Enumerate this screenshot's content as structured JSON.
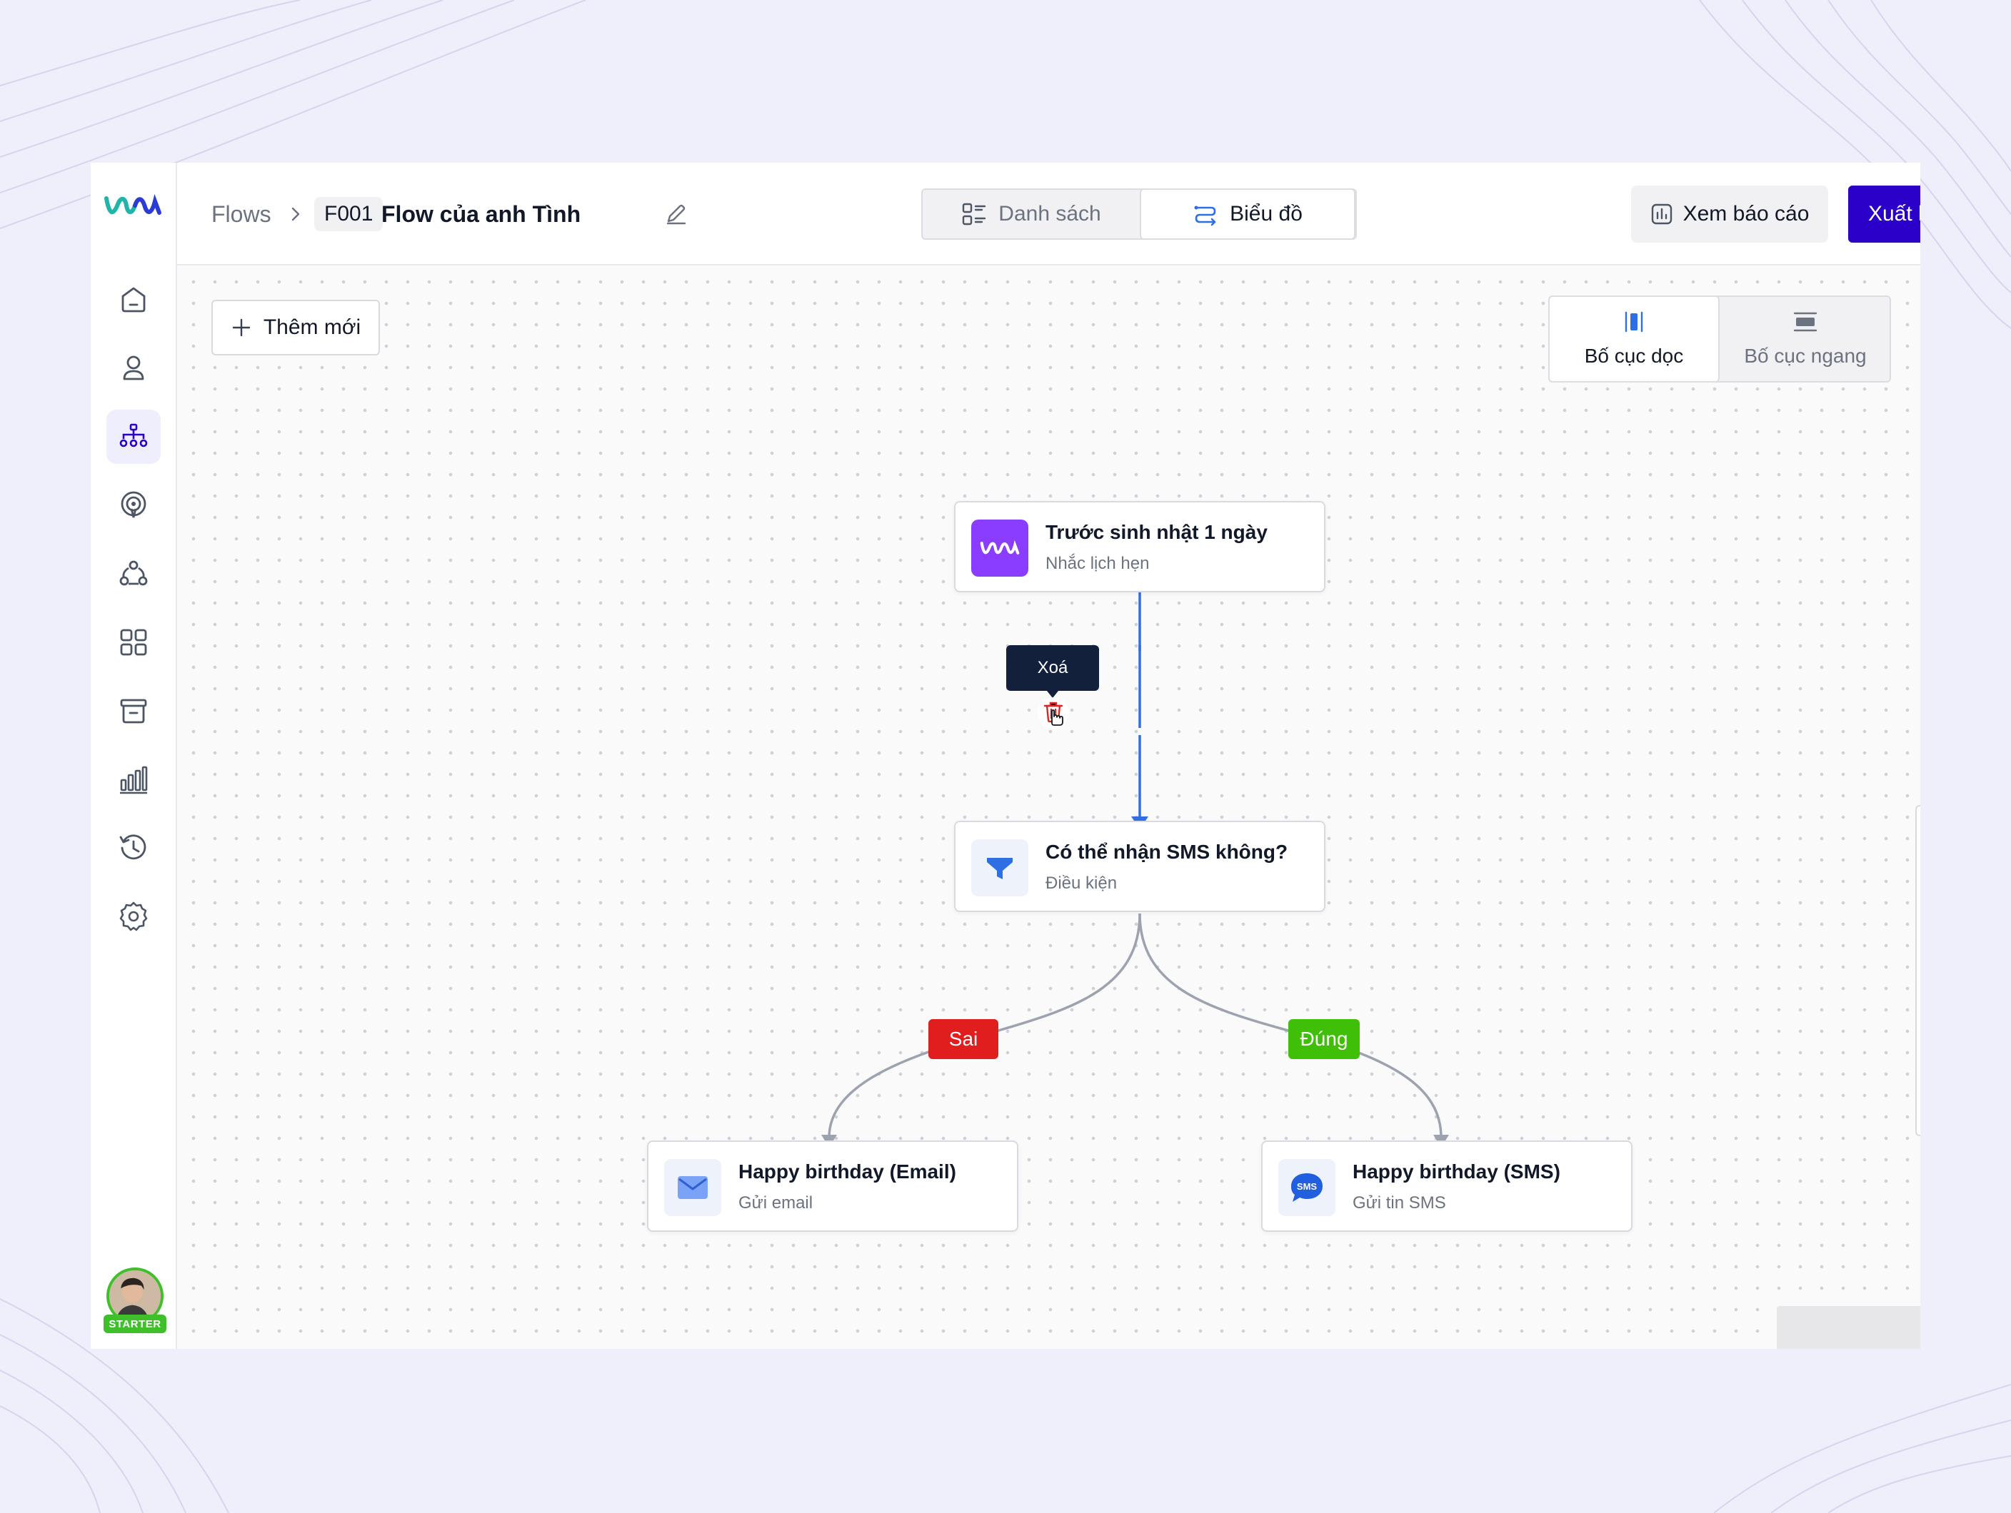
{
  "header": {
    "breadcrumb_root": "Flows",
    "flow_code": "F001",
    "flow_title": "Flow của anh Tình",
    "view_list_label": "Danh sách",
    "view_chart_label": "Biểu đồ",
    "report_label": "Xem báo cáo",
    "publish_label": "Xuất bản"
  },
  "sidebar": {
    "items": [
      {
        "icon": "home-icon"
      },
      {
        "icon": "user-icon"
      },
      {
        "icon": "flow-icon",
        "active": true
      },
      {
        "icon": "broadcast-icon"
      },
      {
        "icon": "segments-icon"
      },
      {
        "icon": "apps-icon"
      },
      {
        "icon": "archive-icon"
      },
      {
        "icon": "bar-chart-icon"
      },
      {
        "icon": "history-icon"
      },
      {
        "icon": "settings-icon"
      }
    ],
    "user_badge": "STARTER"
  },
  "canvas": {
    "add_label": "Thêm mới",
    "layout_vertical_label": "Bố cục dọc",
    "layout_horizontal_label": "Bố cục ngang",
    "delete_tooltip": "Xoá",
    "nodes": [
      {
        "title": "Trước sinh nhật 1 ngày",
        "subtitle": "Nhắc lịch hẹn",
        "icon": "brand-logo-icon"
      },
      {
        "title": "Có thể nhận SMS không?",
        "subtitle": "Điều kiện",
        "icon": "filter-icon"
      },
      {
        "title": "Happy birthday (Email)",
        "subtitle": "Gửi email",
        "icon": "mail-icon"
      },
      {
        "title": "Happy birthday (SMS)",
        "subtitle": "Gửi tin SMS",
        "icon": "sms-icon",
        "icon_text": "SMS"
      }
    ],
    "branch_false_label": "Sai",
    "branch_true_label": "Đúng"
  },
  "colors": {
    "primary": "#2b00c9",
    "brand_purple": "#8b3dff",
    "edge_active": "#2f6fe4",
    "edge": "#9ca3af",
    "false": "#e01e1e",
    "true": "#3fbf08"
  }
}
